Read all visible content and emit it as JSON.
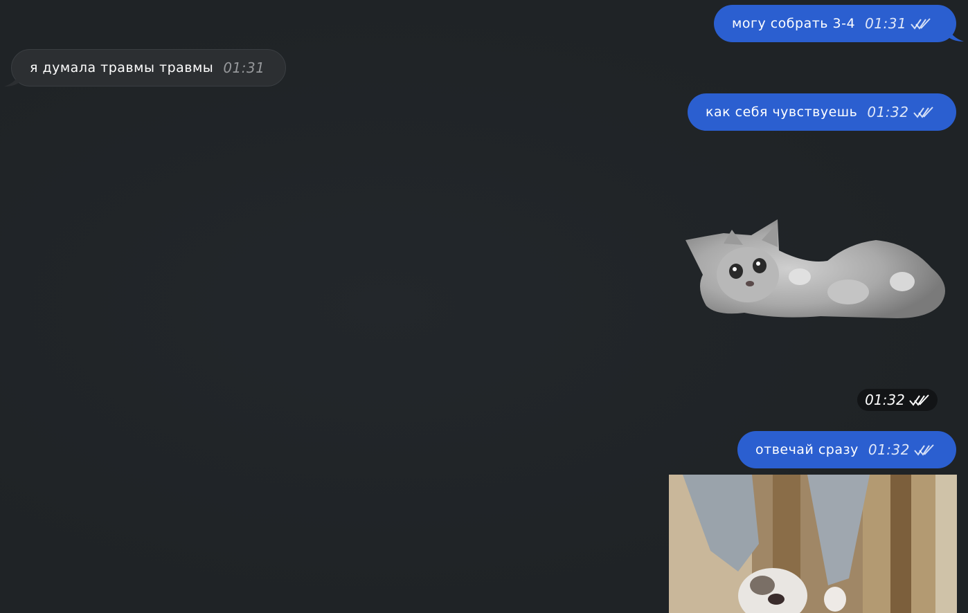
{
  "messages": [
    {
      "text": "могу собрать 3-4",
      "time": "01:31",
      "direction": "out"
    },
    {
      "text": "я думала травмы травмы",
      "time": "01:31",
      "direction": "in"
    },
    {
      "text": "как себя чувствуешь",
      "time": "01:32",
      "direction": "out"
    },
    {
      "text": "отвечай сразу",
      "time": "01:32",
      "direction": "out"
    }
  ],
  "sticker": {
    "time": "01:32",
    "icon": "kitten-sticker"
  },
  "media": {
    "icon": "cat-gif-image"
  },
  "colors": {
    "background": "#212529",
    "outgoing_bubble": "#2b5fd0",
    "incoming_bubble": "#2c2f32"
  }
}
